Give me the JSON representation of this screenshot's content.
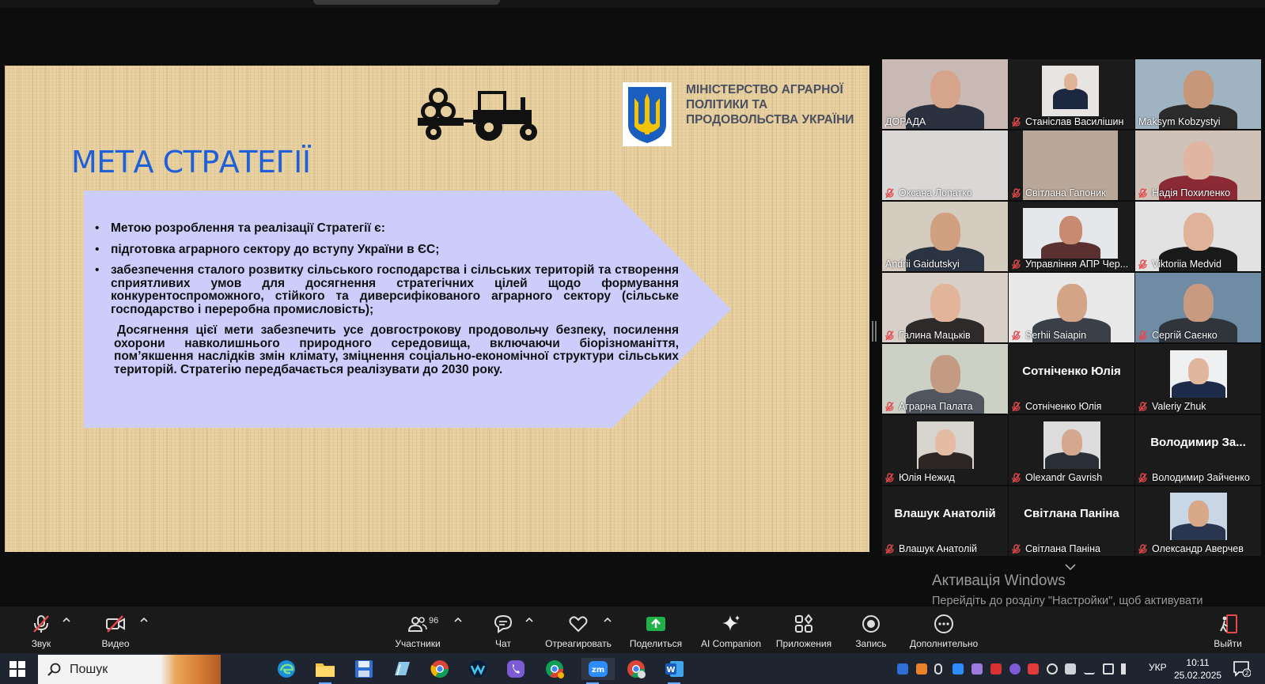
{
  "slide": {
    "title": "МЕТА СТРАТЕГІЇ",
    "ministry_line1": "МІНІСТЕРСТВО АГРАРНОЇ",
    "ministry_line2": "ПОЛІТИКИ ТА",
    "ministry_line3": "ПРОДОВОЛЬСТВА УКРАЇНИ",
    "bullet1": "Метою розроблення та реалізації Стратегії є:",
    "bullet2": "підготовка аграрного сектору до вступу України в ЄС;",
    "bullet3": "забезпечення сталого розвитку сільського господарства і сільських територій та створення сприятливих умов для досягнення стратегічних цілей щодо формування конкурентоспроможного, стійкого та диверсифікованого аграрного сектору (сільське господарство і переробна промисловість);",
    "paragraph": "Досягнення цієї мети забезпечить усе довгострокову продовольчу безпеку, посилення охорони навколишнього природного середовища, включаючи біорізноманіття, пом’якшення наслідків змін клімату, зміцнення соціально-економічної структури сільських територій. Стратегію передбачається реалізувати до 2030 року."
  },
  "participants": [
    {
      "name": "ДОРАДА",
      "muted": false,
      "video": true,
      "bg": "#c8b9b5",
      "skin": "#d6a48a",
      "cloth": "#2c3140"
    },
    {
      "name": "Станіслав Василішин",
      "muted": true,
      "video": true,
      "bg": "#e7e4e2",
      "skin": "#e0b394",
      "cloth": "#1c2840"
    },
    {
      "name": "Maksym Kobzystyi",
      "muted": false,
      "video": true,
      "active": true,
      "bg": "#9fb4c0",
      "skin": "#c89678",
      "cloth": "#2b2b2b"
    },
    {
      "name": "Оксана Лопатко",
      "muted": true,
      "video": true,
      "bg": "#d9d8d6",
      "skin": "",
      "cloth": ""
    },
    {
      "name": "Світлана Гапоник",
      "muted": true,
      "video": true,
      "bg": "#b9a89a",
      "skin": "",
      "cloth": ""
    },
    {
      "name": "Надія Похиленко",
      "muted": true,
      "video": true,
      "bg": "#cfc3b9",
      "skin": "#e0b6a2",
      "cloth": "#8a2a35"
    },
    {
      "name": "Andrii Gaidutskyi",
      "muted": false,
      "video": true,
      "bg": "#d5ccc0",
      "skin": "#d1a080",
      "cloth": "#2a3442"
    },
    {
      "name": "Управління АПР Чер...",
      "muted": true,
      "video": true,
      "bg": "#e4e8ea",
      "skin": "#c88a70",
      "cloth": "#5a3030"
    },
    {
      "name": "Viktoriia Medvid",
      "muted": true,
      "video": true,
      "bg": "#e2e2e2",
      "skin": "#e0b29a",
      "cloth": "#1a1a1a"
    },
    {
      "name": "Галина Мацьків",
      "muted": true,
      "video": true,
      "bg": "#d8d0c8",
      "skin": "#e2b59a",
      "cloth": "#2e2a2a"
    },
    {
      "name": "Serhii Saiapin",
      "muted": true,
      "video": true,
      "bg": "#e8e8e8",
      "skin": "#d4a487",
      "cloth": "#3a3f48"
    },
    {
      "name": "Сергій  Саєнко",
      "muted": true,
      "video": true,
      "bg": "#6f8ca4",
      "skin": "#c89a80",
      "cloth": "#30353c"
    },
    {
      "name": "Аграрна Палата",
      "muted": true,
      "video": true,
      "bg": "#cdd0c4",
      "skin": "#c39a82",
      "cloth": "#50555e"
    },
    {
      "name": "Сотніченко Юлія",
      "muted": true,
      "video": false,
      "big": "Сотніченко Юлія"
    },
    {
      "name": "Valeriy Zhuk",
      "muted": true,
      "video": true,
      "small": true,
      "bg": "#eef0f2",
      "skin": "#e0b69c",
      "cloth": "#1d2a48"
    },
    {
      "name": "Юлія Нежид",
      "muted": true,
      "video": true,
      "small": true,
      "bg": "#d8d4ce",
      "skin": "#e4bca4",
      "cloth": "#2c2624"
    },
    {
      "name": "Olexandr Gavrish",
      "muted": true,
      "video": true,
      "small": true,
      "bg": "#dcdcdc",
      "skin": "#d4a88e",
      "cloth": "#2a2e36"
    },
    {
      "name": "Володимир Зайченко",
      "muted": true,
      "video": false,
      "big": "Володимир  За..."
    },
    {
      "name": "Влашук Анатолій",
      "muted": true,
      "video": false,
      "big": "Влашук Анатолій"
    },
    {
      "name": "Світлана Паніна",
      "muted": true,
      "video": false,
      "big": "Світлана Паніна"
    },
    {
      "name": "Олександр Аверчев",
      "muted": true,
      "video": true,
      "small": true,
      "bg": "#c8d6e6",
      "skin": "#d8a888",
      "cloth": "#2a3550"
    }
  ],
  "watermark": {
    "title": "Активація Windows",
    "subtitle": "Перейдіть до розділу \"Настройки\", щоб активувати Windows."
  },
  "toolbar": {
    "audio": "Звук",
    "video": "Видео",
    "participants": "Участники",
    "participants_count": "96",
    "chat": "Чат",
    "react": "Отреагировать",
    "share": "Поделиться",
    "ai": "AI Companion",
    "apps": "Приложения",
    "record": "Запись",
    "more": "Дополнительно",
    "leave": "Выйти"
  },
  "taskbar": {
    "search": "Пошук",
    "lang": "УКР",
    "time": "10:11",
    "date": "25.02.2025",
    "notif_count": "2"
  },
  "colors": {
    "slide_title": "#1f5fd8",
    "arrow_fill": "#cccdfb",
    "active_speaker": "#26c281",
    "mute_red": "#e5484d",
    "share_green": "#21b14b"
  }
}
